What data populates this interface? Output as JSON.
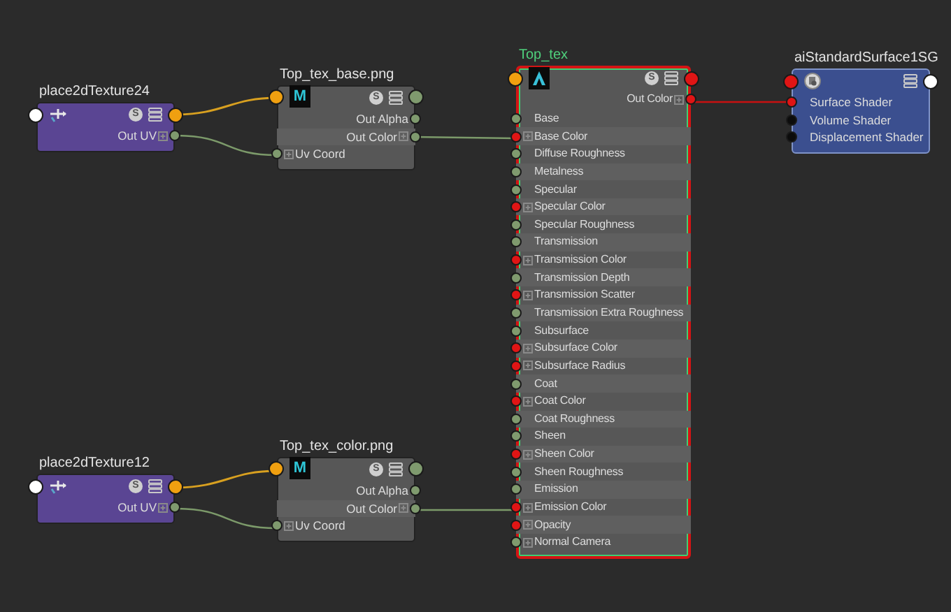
{
  "nodes": [
    {
      "kind": "place2d",
      "title": "place2dTexture24",
      "selected": false,
      "badge": "S",
      "outputs": [
        {
          "label": "Out UV",
          "kind": "vector"
        }
      ]
    },
    {
      "kind": "file",
      "title": "Top_tex_base.png",
      "selected": false,
      "logo": "M",
      "badge": "S",
      "outputs": [
        {
          "label": "Out Alpha",
          "kind": "scalar"
        },
        {
          "label": "Out Color",
          "kind": "vector"
        }
      ],
      "inputs": [
        {
          "label": "Uv Coord",
          "kind": "vector"
        }
      ]
    },
    {
      "kind": "shader",
      "title": "Top_tex",
      "selected": true,
      "badge": "S",
      "outputs": [
        {
          "label": "Out Color",
          "kind": "color"
        }
      ],
      "inputs": [
        {
          "label": "Base",
          "kind": "scalar"
        },
        {
          "label": "Base Color",
          "kind": "color"
        },
        {
          "label": "Diffuse Roughness",
          "kind": "scalar"
        },
        {
          "label": "Metalness",
          "kind": "scalar"
        },
        {
          "label": "Specular",
          "kind": "scalar"
        },
        {
          "label": "Specular Color",
          "kind": "color"
        },
        {
          "label": "Specular Roughness",
          "kind": "scalar"
        },
        {
          "label": "Transmission",
          "kind": "scalar"
        },
        {
          "label": "Transmission Color",
          "kind": "color"
        },
        {
          "label": "Transmission Depth",
          "kind": "scalar"
        },
        {
          "label": "Transmission Scatter",
          "kind": "color"
        },
        {
          "label": "Transmission Extra Roughness",
          "kind": "scalar"
        },
        {
          "label": "Subsurface",
          "kind": "scalar"
        },
        {
          "label": "Subsurface Color",
          "kind": "color"
        },
        {
          "label": "Subsurface Radius",
          "kind": "color"
        },
        {
          "label": "Coat",
          "kind": "scalar"
        },
        {
          "label": "Coat Color",
          "kind": "color"
        },
        {
          "label": "Coat Roughness",
          "kind": "scalar"
        },
        {
          "label": "Sheen",
          "kind": "scalar"
        },
        {
          "label": "Sheen Color",
          "kind": "color"
        },
        {
          "label": "Sheen Roughness",
          "kind": "scalar"
        },
        {
          "label": "Emission",
          "kind": "scalar"
        },
        {
          "label": "Emission Color",
          "kind": "color"
        },
        {
          "label": "Opacity",
          "kind": "color"
        },
        {
          "label": "Normal Camera",
          "kind": "vector"
        }
      ]
    },
    {
      "kind": "group",
      "title": "aiStandardSurface1SG",
      "selected": false,
      "inputs": [
        {
          "label": "Surface Shader",
          "kind": "shader"
        },
        {
          "label": "Volume Shader",
          "kind": "empty"
        },
        {
          "label": "Displacement Shader",
          "kind": "empty"
        }
      ]
    },
    {
      "kind": "place2d",
      "title": "place2dTexture12",
      "selected": false,
      "badge": "S",
      "outputs": [
        {
          "label": "Out UV",
          "kind": "vector"
        }
      ]
    },
    {
      "kind": "file",
      "title": "Top_tex_color.png",
      "selected": false,
      "logo": "M",
      "badge": "S",
      "outputs": [
        {
          "label": "Out Alpha",
          "kind": "scalar"
        },
        {
          "label": "Out Color",
          "kind": "vector"
        }
      ],
      "inputs": [
        {
          "label": "Uv Coord",
          "kind": "vector"
        }
      ]
    }
  ]
}
